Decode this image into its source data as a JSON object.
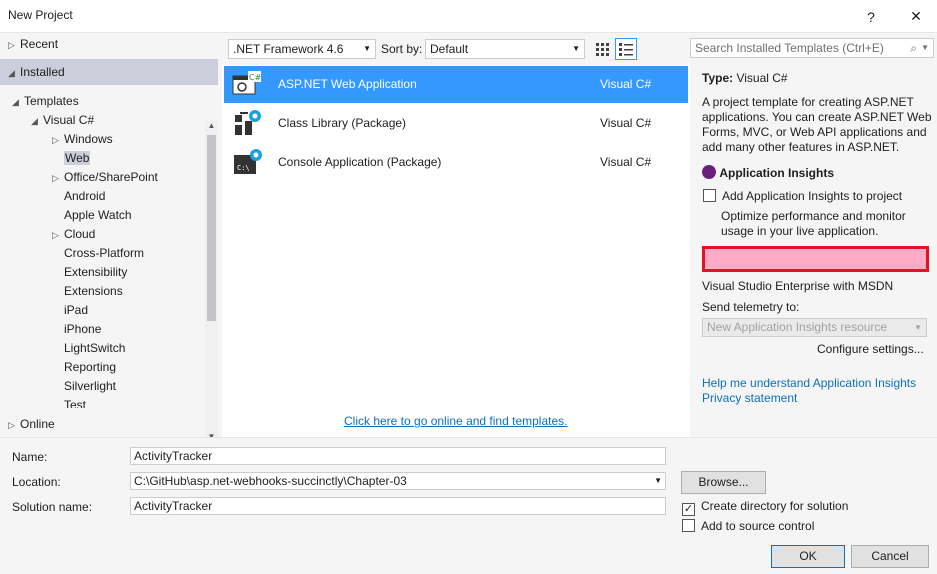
{
  "window": {
    "title": "New Project",
    "help_label": "?",
    "close_label": "✕"
  },
  "sidebar": {
    "recent": "Recent",
    "installed": "Installed",
    "templates": "Templates",
    "visual_csharp": "Visual C#",
    "items": [
      "Windows",
      "Web",
      "Office/SharePoint",
      "Android",
      "Apple Watch",
      "Cloud",
      "Cross-Platform",
      "Extensibility",
      "Extensions",
      "iPad",
      "iPhone",
      "LightSwitch",
      "Reporting",
      "Silverlight",
      "Test"
    ],
    "expandable": [
      "Windows",
      "Office/SharePoint",
      "Cloud"
    ],
    "selected": "Web",
    "online": "Online"
  },
  "toolbar": {
    "framework": ".NET Framework 4.6",
    "sort_label": "Sort by:",
    "sort_value": "Default"
  },
  "search": {
    "placeholder": "Search Installed Templates (Ctrl+E)"
  },
  "templates": [
    {
      "name": "ASP.NET Web Application",
      "lang": "Visual C#",
      "icon": "web-application-icon"
    },
    {
      "name": "Class Library (Package)",
      "lang": "Visual C#",
      "icon": "class-library-icon"
    },
    {
      "name": "Console Application (Package)",
      "lang": "Visual C#",
      "icon": "console-application-icon"
    }
  ],
  "online_link": "Click here to go online and find templates.",
  "details": {
    "type_label": "Type:",
    "type_value": "Visual C#",
    "description": "A project template for creating ASP.NET applications. You can create ASP.NET Web Forms, MVC, or Web API applications and add many other features in ASP.NET.",
    "insights_title": "Application Insights",
    "add_insights": "Add Application Insights to project",
    "insights_desc": "Optimize performance and monitor usage in your live application.",
    "account": "Visual Studio Enterprise with MSDN",
    "telemetry_label": "Send telemetry to:",
    "telemetry_value": "New Application Insights resource",
    "configure": "Configure settings...",
    "help_link": "Help me understand Application Insights",
    "privacy_link": "Privacy statement"
  },
  "form": {
    "name_label": "Name:",
    "name_value": "ActivityTracker",
    "location_label": "Location:",
    "location_value": "C:\\GitHub\\asp.net-webhooks-succinctly\\Chapter-03",
    "solution_label": "Solution name:",
    "solution_value": "ActivityTracker",
    "browse": "Browse...",
    "create_dir": "Create directory for solution",
    "source_control": "Add to source control",
    "ok": "OK",
    "cancel": "Cancel"
  },
  "colors": {
    "selection": "#3399ff",
    "link": "#0e70c0",
    "highlight_border": "#e81123"
  }
}
